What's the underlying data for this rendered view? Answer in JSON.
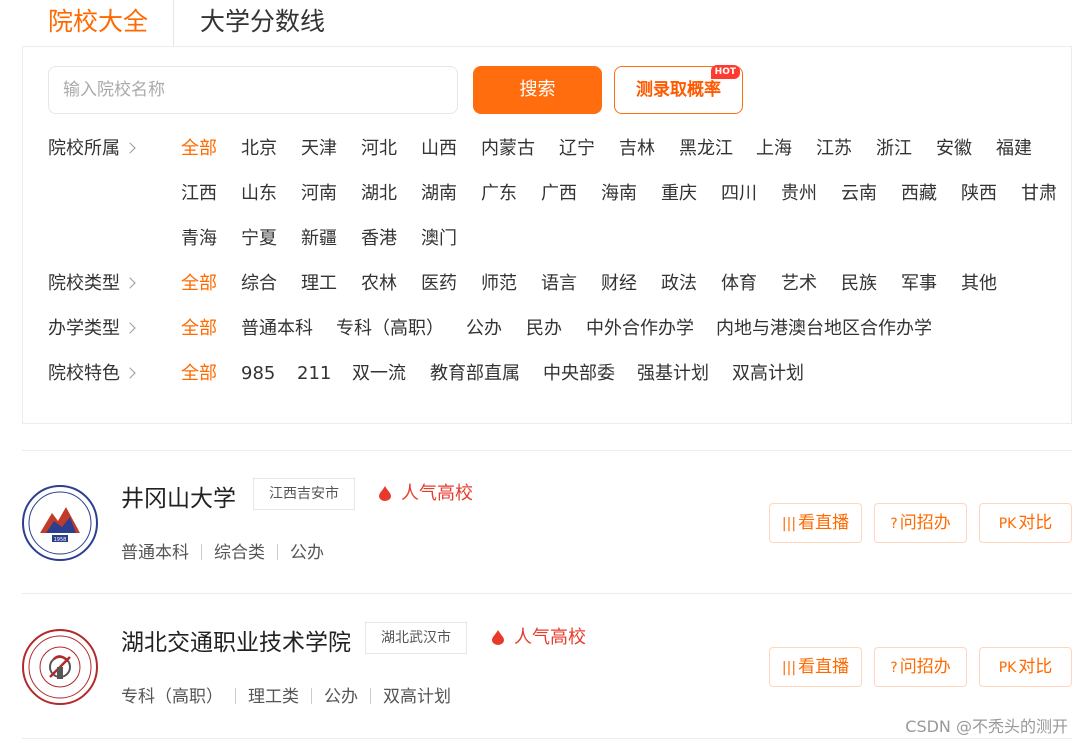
{
  "tabs": {
    "active": "院校大全",
    "second": "大学分数线"
  },
  "search": {
    "placeholder": "输入院校名称",
    "button": "搜索",
    "rate_button": "测录取概率",
    "hot_badge": "HOT"
  },
  "filters": {
    "affiliation": {
      "label": "院校所属",
      "options": [
        "全部",
        "北京",
        "天津",
        "河北",
        "山西",
        "内蒙古",
        "辽宁",
        "吉林",
        "黑龙江",
        "上海",
        "江苏",
        "浙江",
        "安徽",
        "福建",
        "江西",
        "山东",
        "河南",
        "湖北",
        "湖南",
        "广东",
        "广西",
        "海南",
        "重庆",
        "四川",
        "贵州",
        "云南",
        "西藏",
        "陕西",
        "甘肃",
        "青海",
        "宁夏",
        "新疆",
        "香港",
        "澳门"
      ]
    },
    "type": {
      "label": "院校类型",
      "options": [
        "全部",
        "综合",
        "理工",
        "农林",
        "医药",
        "师范",
        "语言",
        "财经",
        "政法",
        "体育",
        "艺术",
        "民族",
        "军事",
        "其他"
      ]
    },
    "school_type": {
      "label": "办学类型",
      "options": [
        "全部",
        "普通本科",
        "专科（高职）",
        "公办",
        "民办",
        "中外合作办学",
        "内地与港澳台地区合作办学"
      ]
    },
    "feature": {
      "label": "院校特色",
      "options": [
        "全部",
        "985",
        "211",
        "双一流",
        "教育部直属",
        "中央部委",
        "强基计划",
        "双高计划"
      ]
    }
  },
  "universities": [
    {
      "name": "井冈山大学",
      "location": "江西吉安市",
      "popular": "人气高校",
      "tags": [
        "普通本科",
        "综合类",
        "公办"
      ],
      "logo_year": "1958",
      "logo_text": "JINGGANGSHAN UNIVERSITY"
    },
    {
      "name": "湖北交通职业技术学院",
      "location": "湖北武汉市",
      "popular": "人气高校",
      "tags": [
        "专科（高职）",
        "理工类",
        "公办",
        "双高计划"
      ],
      "logo_text": "HUBEI COMMUNICATIONS TECHNICAL COLLEGE"
    }
  ],
  "actions": {
    "live": "看直播",
    "ask": "问招办",
    "compare": "对比"
  },
  "watermark": "CSDN @不秃头的测开",
  "colors": {
    "accent": "#ff6a00",
    "popular": "#e63c2d"
  }
}
